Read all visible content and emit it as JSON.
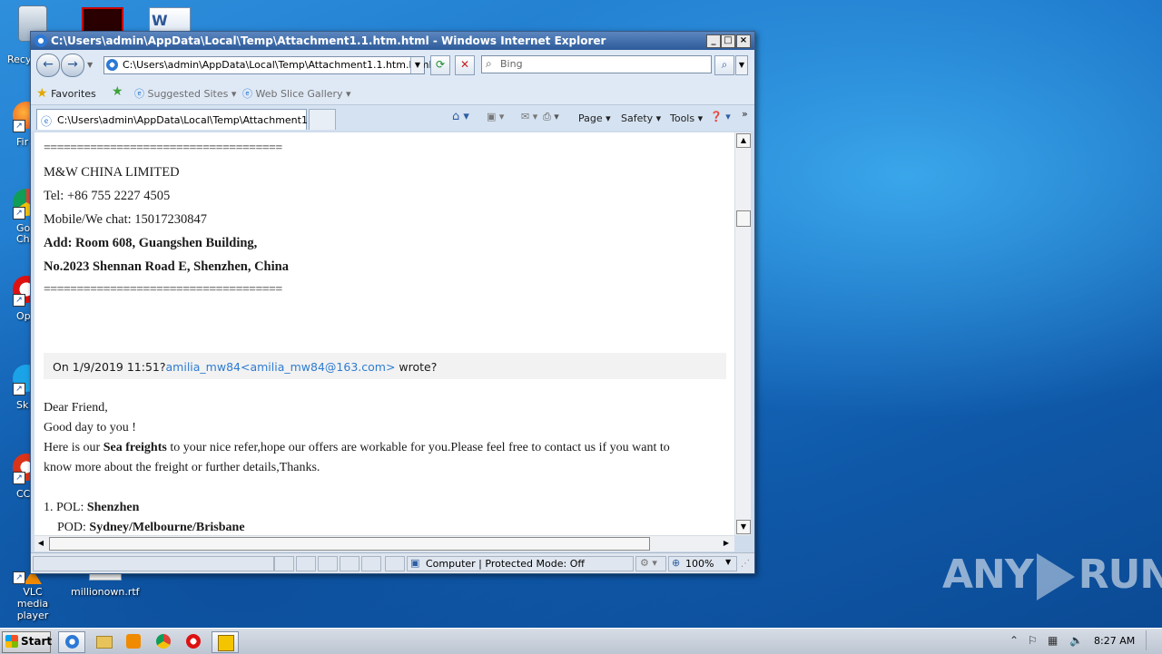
{
  "desktop": {
    "icons": [
      {
        "label": "Recy",
        "id": "recycle"
      },
      {
        "label": "Fir",
        "id": "firefox"
      },
      {
        "label": "Go\nChr",
        "id": "chrome"
      },
      {
        "label": "Op",
        "id": "opera"
      },
      {
        "label": "Sk",
        "id": "skype"
      },
      {
        "label": "CCl",
        "id": "ccleaner"
      },
      {
        "label": "VLC media\nplayer",
        "id": "vlc"
      },
      {
        "label": "millionown.rtf",
        "id": "rtf"
      }
    ]
  },
  "window": {
    "title": "C:\\Users\\admin\\AppData\\Local\\Temp\\Attachment1.1.htm.html - Windows Internet Explorer",
    "address": "C:\\Users\\admin\\AppData\\Local\\Temp\\Attachment1.1.htm.html",
    "search_placeholder": "Bing",
    "favorites": "Favorites",
    "suggested_sites": "Suggested Sites",
    "web_slice_gallery": "Web Slice Gallery",
    "tab_title": "C:\\Users\\admin\\AppData\\Local\\Temp\\Attachment1.1....",
    "commands": {
      "page": "Page",
      "safety": "Safety",
      "tools": "Tools"
    },
    "status": {
      "zone": "Computer | Protected Mode: Off",
      "zoom": "100%"
    }
  },
  "email": {
    "separator": "====================================",
    "signature": {
      "company": "M&W CHINA LIMITED",
      "tel": "Tel: +86 755 2227 4505",
      "mobile": "Mobile/We chat: 15017230847",
      "add1": "Add: Room 608, Guangshen Building,",
      "add2": "No.2023 Shennan Road E, Shenzhen, China"
    },
    "quote": {
      "prefix": "On 1/9/2019 11:51?",
      "link": "amilia_mw84<amilia_mw84@163.com>",
      "suffix": " wrote?"
    },
    "body": {
      "greeting": "Dear Friend,",
      "line2": "Good day to you !",
      "line3_pre": "Here is our ",
      "line3_bold": "Sea freights",
      "line3_post": " to your nice refer,hope our offers are workable for you.Please feel free to contact us if you want to",
      "line4": "know more about the freight or further details,Thanks.",
      "pol_label": "1. POL: ",
      "pol_value": "Shenzhen",
      "pod_label": "POD: ",
      "pod_value": "Sydney/Melbourne/Brisbane"
    }
  },
  "taskbar": {
    "start": "Start",
    "clock": "8:27 AM"
  },
  "watermark": "ANY RUN",
  "colors": {
    "accent": "#2f7cd0",
    "desktop": "#1b74c9"
  }
}
